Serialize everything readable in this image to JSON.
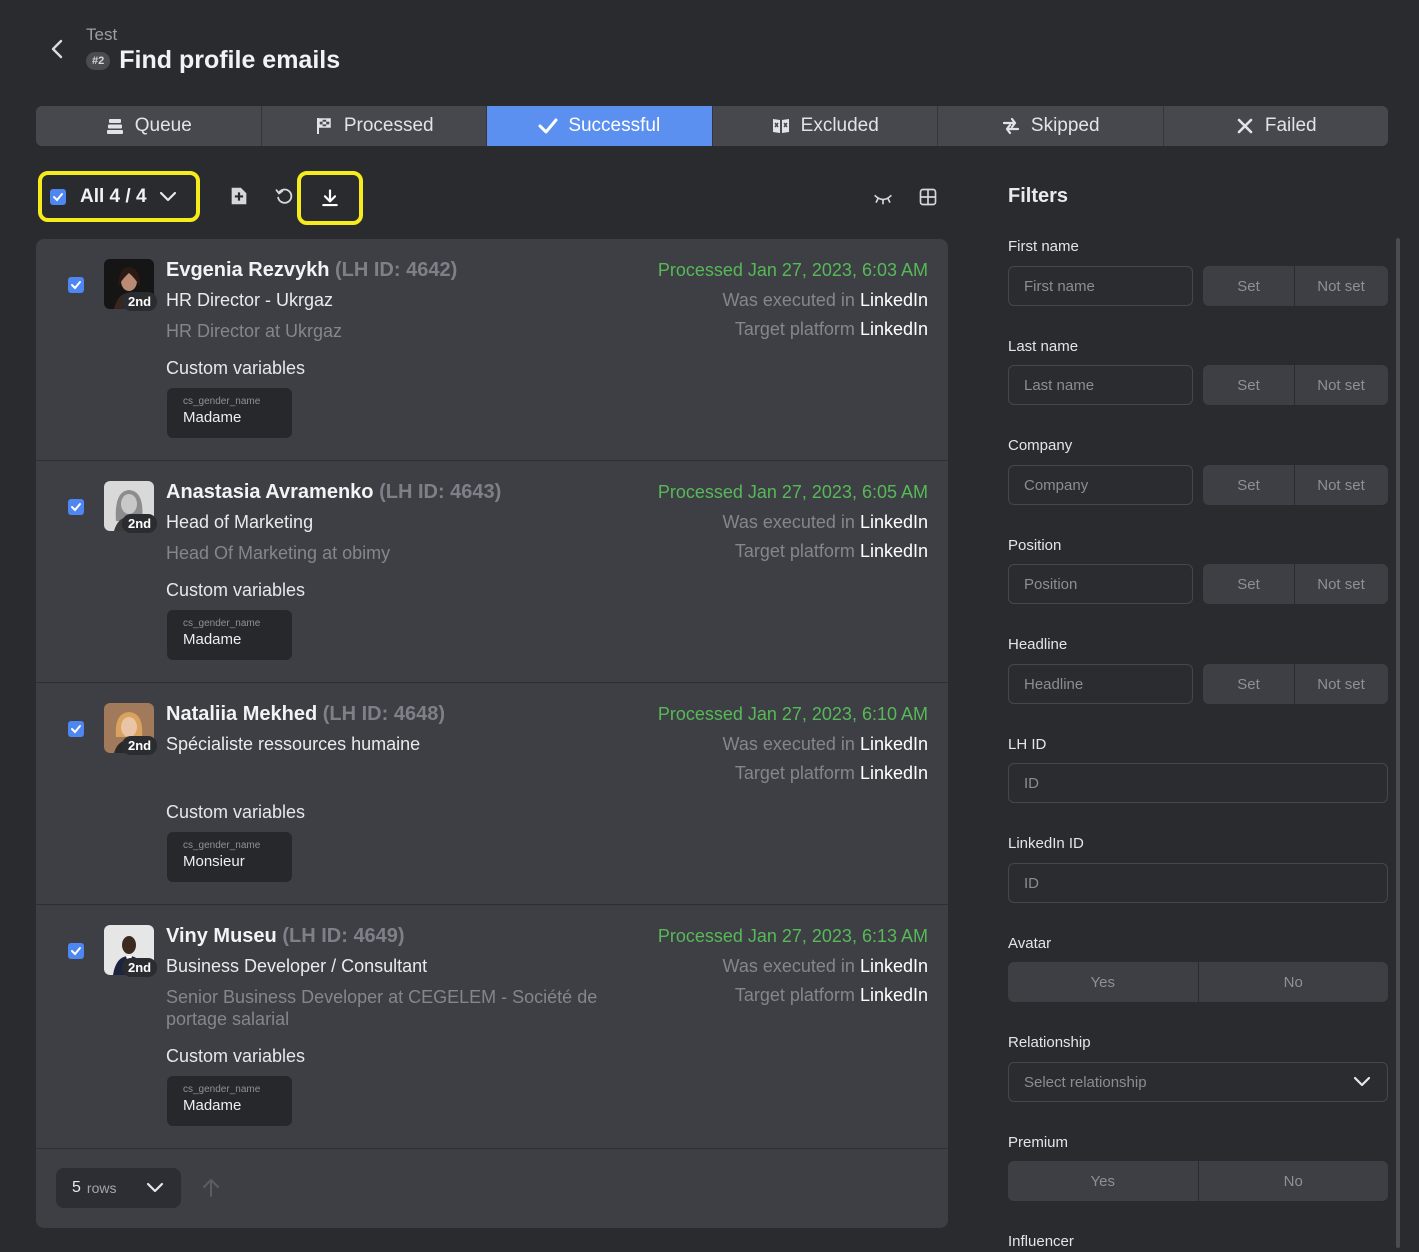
{
  "header": {
    "subtitle": "Test",
    "campaign_number": "#2",
    "title": "Find profile emails"
  },
  "tabs": [
    {
      "label": "Queue",
      "icon": "queue-icon",
      "active": false
    },
    {
      "label": "Processed",
      "icon": "flag-icon",
      "active": false
    },
    {
      "label": "Successful",
      "icon": "check-icon",
      "active": true
    },
    {
      "label": "Excluded",
      "icon": "excluded-icon",
      "active": false
    },
    {
      "label": "Skipped",
      "icon": "skip-arrows-icon",
      "active": false
    },
    {
      "label": "Failed",
      "icon": "x-icon",
      "active": false
    }
  ],
  "toolbar": {
    "select_label": "All 4 / 4",
    "icons": [
      "add-icon",
      "refresh-icon",
      "download-icon",
      "hide-icon",
      "grid-view-icon"
    ],
    "highlight_color": "#f7ec1b"
  },
  "profiles": [
    {
      "name": "Evgenia Rezvykh",
      "lh_id": "(LH ID: 4642)",
      "degree": "2nd",
      "headline": "HR Director - Ukrgaz",
      "position": "HR Director at Ukrgaz",
      "processed": "Processed Jan 27, 2023, 6:03 AM",
      "executed_prefix": "Was executed in",
      "executed_platform": "LinkedIn",
      "target_prefix": "Target platform",
      "target_platform": "LinkedIn",
      "cv_label": "Custom variables",
      "cv_key": "cs_gender_name",
      "cv_value": "Madame"
    },
    {
      "name": "Anastasia Avramenko",
      "lh_id": "(LH ID: 4643)",
      "degree": "2nd",
      "headline": "Head of Marketing",
      "position": "Head Of Marketing at obimy",
      "processed": "Processed Jan 27, 2023, 6:05 AM",
      "executed_prefix": "Was executed in",
      "executed_platform": "LinkedIn",
      "target_prefix": "Target platform",
      "target_platform": "LinkedIn",
      "cv_label": "Custom variables",
      "cv_key": "cs_gender_name",
      "cv_value": "Madame"
    },
    {
      "name": "Nataliia Mekhed",
      "lh_id": "(LH ID: 4648)",
      "degree": "2nd",
      "headline": "Spécialiste ressources humaine",
      "position": "",
      "processed": "Processed Jan 27, 2023, 6:10 AM",
      "executed_prefix": "Was executed in",
      "executed_platform": "LinkedIn",
      "target_prefix": "Target platform",
      "target_platform": "LinkedIn",
      "cv_label": "Custom variables",
      "cv_key": "cs_gender_name",
      "cv_value": "Monsieur"
    },
    {
      "name": "Viny Museu",
      "lh_id": "(LH ID: 4649)",
      "degree": "2nd",
      "headline": "Business Developer / Consultant",
      "position": "Senior Business Developer at CEGELEM - Société de portage salarial",
      "processed": "Processed Jan 27, 2023, 6:13 AM",
      "executed_prefix": "Was executed in",
      "executed_platform": "LinkedIn",
      "target_prefix": "Target platform",
      "target_platform": "LinkedIn",
      "cv_label": "Custom variables",
      "cv_key": "cs_gender_name",
      "cv_value": "Madame"
    }
  ],
  "pagination": {
    "rows_value": "5",
    "rows_label": "rows"
  },
  "filters": {
    "title": "Filters",
    "first_name": {
      "label": "First name",
      "placeholder": "First name",
      "set": "Set",
      "not_set": "Not set"
    },
    "last_name": {
      "label": "Last name",
      "placeholder": "Last name",
      "set": "Set",
      "not_set": "Not set"
    },
    "company": {
      "label": "Company",
      "placeholder": "Company",
      "set": "Set",
      "not_set": "Not set"
    },
    "position": {
      "label": "Position",
      "placeholder": "Position",
      "set": "Set",
      "not_set": "Not set"
    },
    "headline": {
      "label": "Headline",
      "placeholder": "Headline",
      "set": "Set",
      "not_set": "Not set"
    },
    "lh_id": {
      "label": "LH ID",
      "placeholder": "ID"
    },
    "linkedin_id": {
      "label": "LinkedIn ID",
      "placeholder": "ID"
    },
    "avatar": {
      "label": "Avatar",
      "yes": "Yes",
      "no": "No"
    },
    "relationship": {
      "label": "Relationship",
      "placeholder": "Select relationship"
    },
    "premium": {
      "label": "Premium",
      "yes": "Yes",
      "no": "No"
    },
    "influencer": {
      "label": "Influencer"
    }
  },
  "colors": {
    "accent": "#5b8ff0",
    "processed_green": "#57b957",
    "background": "#2a2b2f"
  }
}
